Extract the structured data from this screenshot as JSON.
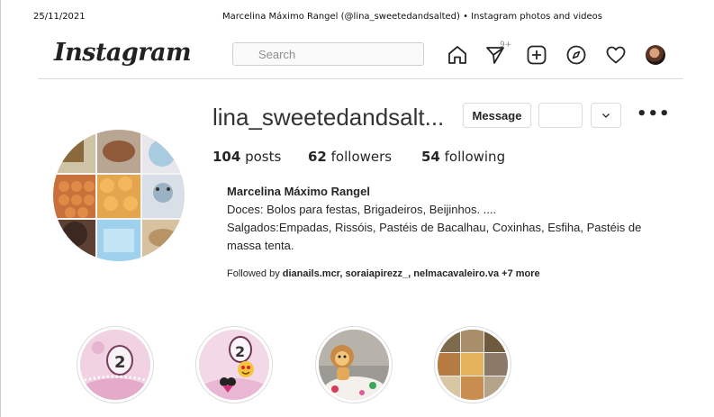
{
  "print_header": {
    "date": "25/11/2021",
    "title": "Marcelina Máximo Rangel (@lina_sweetedandsalted) • Instagram photos and videos"
  },
  "nav": {
    "logo": "Instagram",
    "search_placeholder": "Search",
    "direct_badge": "9+",
    "icons": [
      "home-icon",
      "direct-icon",
      "new-post-icon",
      "explore-icon",
      "heart-icon",
      "avatar"
    ]
  },
  "profile": {
    "username": "lina_sweetedandsalt...",
    "message_label": "Message",
    "posts_count": "104",
    "posts_label": "posts",
    "followers_count": "62",
    "followers_label": "followers",
    "following_count": "54",
    "following_label": "following",
    "full_name": "Marcelina Máximo Rangel",
    "bio_lines": [
      "Doces: Bolos para festas, Brigadeiros, Beijinhos. ....",
      "Salgados:Empadas, Rissóis, Pastéis de Bacalhau, Coxinhas, Esfiha, Pastéis de massa tenta."
    ],
    "followed_by_prefix": "Followed by",
    "followed_by_names": "dianails.mcr, soraiapirezz_, nelmacavaleiro.va",
    "followed_by_more": "+7 more"
  },
  "highlights": [
    {
      "id": "pink-cake-2"
    },
    {
      "id": "pink-cake-2-emoji"
    },
    {
      "id": "lion-cake"
    },
    {
      "id": "food-collage"
    }
  ],
  "colors": {
    "text": "#262626",
    "muted": "#8e8e8e",
    "border": "#dbdbdb"
  }
}
